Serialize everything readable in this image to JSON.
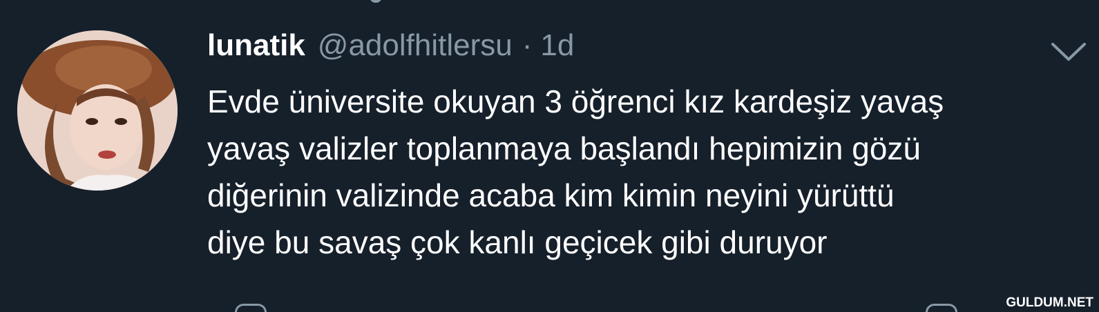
{
  "tweet": {
    "display_name": "lunatik",
    "handle": "@adolfhitlersu",
    "separator": "·",
    "time": "1d",
    "text_lines": [
      "Evde üniversite okuyan 3 öğrenci kız kardeşiz yavaş",
      "yavaş valizler toplanmaya başlandı hepimizin gözü",
      "diğerinin valizinde acaba kim kimin neyini yürüttü",
      "diye bu savaş çok kanlı geçicek gibi duruyor"
    ]
  },
  "icons": {
    "avatar": "profile-photo",
    "menu": "chevron-down-icon"
  },
  "watermark": "GULDUM.NET",
  "colors": {
    "background": "#16202b",
    "primary_text": "#ffffff",
    "secondary_text": "#8899a6"
  }
}
